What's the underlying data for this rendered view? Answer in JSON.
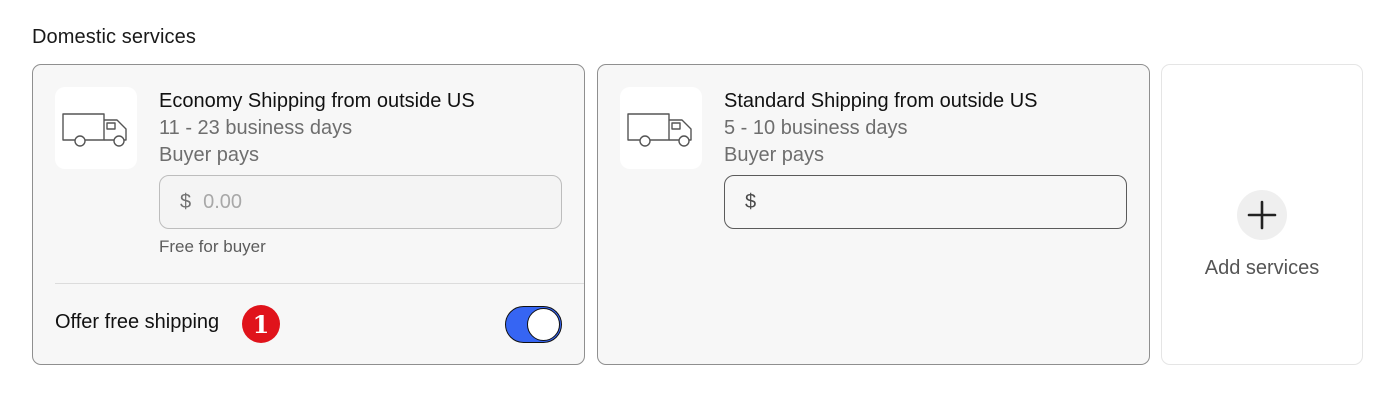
{
  "section": {
    "title": "Domestic services"
  },
  "services": [
    {
      "name": "Economy Shipping from outside US",
      "duration": "11 - 23 business days",
      "payer": "Buyer pays",
      "currency_symbol": "$",
      "price_value": "",
      "price_placeholder": "0.00",
      "note": "Free for buyer",
      "free_shipping_label": "Offer free shipping",
      "badge": "1",
      "free_shipping_on": true,
      "icon": "truck-icon"
    },
    {
      "name": "Standard Shipping from outside US",
      "duration": "5 - 10 business days",
      "payer": "Buyer pays",
      "currency_symbol": "$",
      "price_value": "",
      "price_placeholder": "",
      "icon": "truck-icon"
    }
  ],
  "add_services": {
    "label": "Add services",
    "icon": "plus-icon"
  },
  "colors": {
    "toggle_on": "#3665f3",
    "badge": "#e0131b",
    "card_bg": "#f7f7f7",
    "card_border": "#8f8f8f"
  }
}
